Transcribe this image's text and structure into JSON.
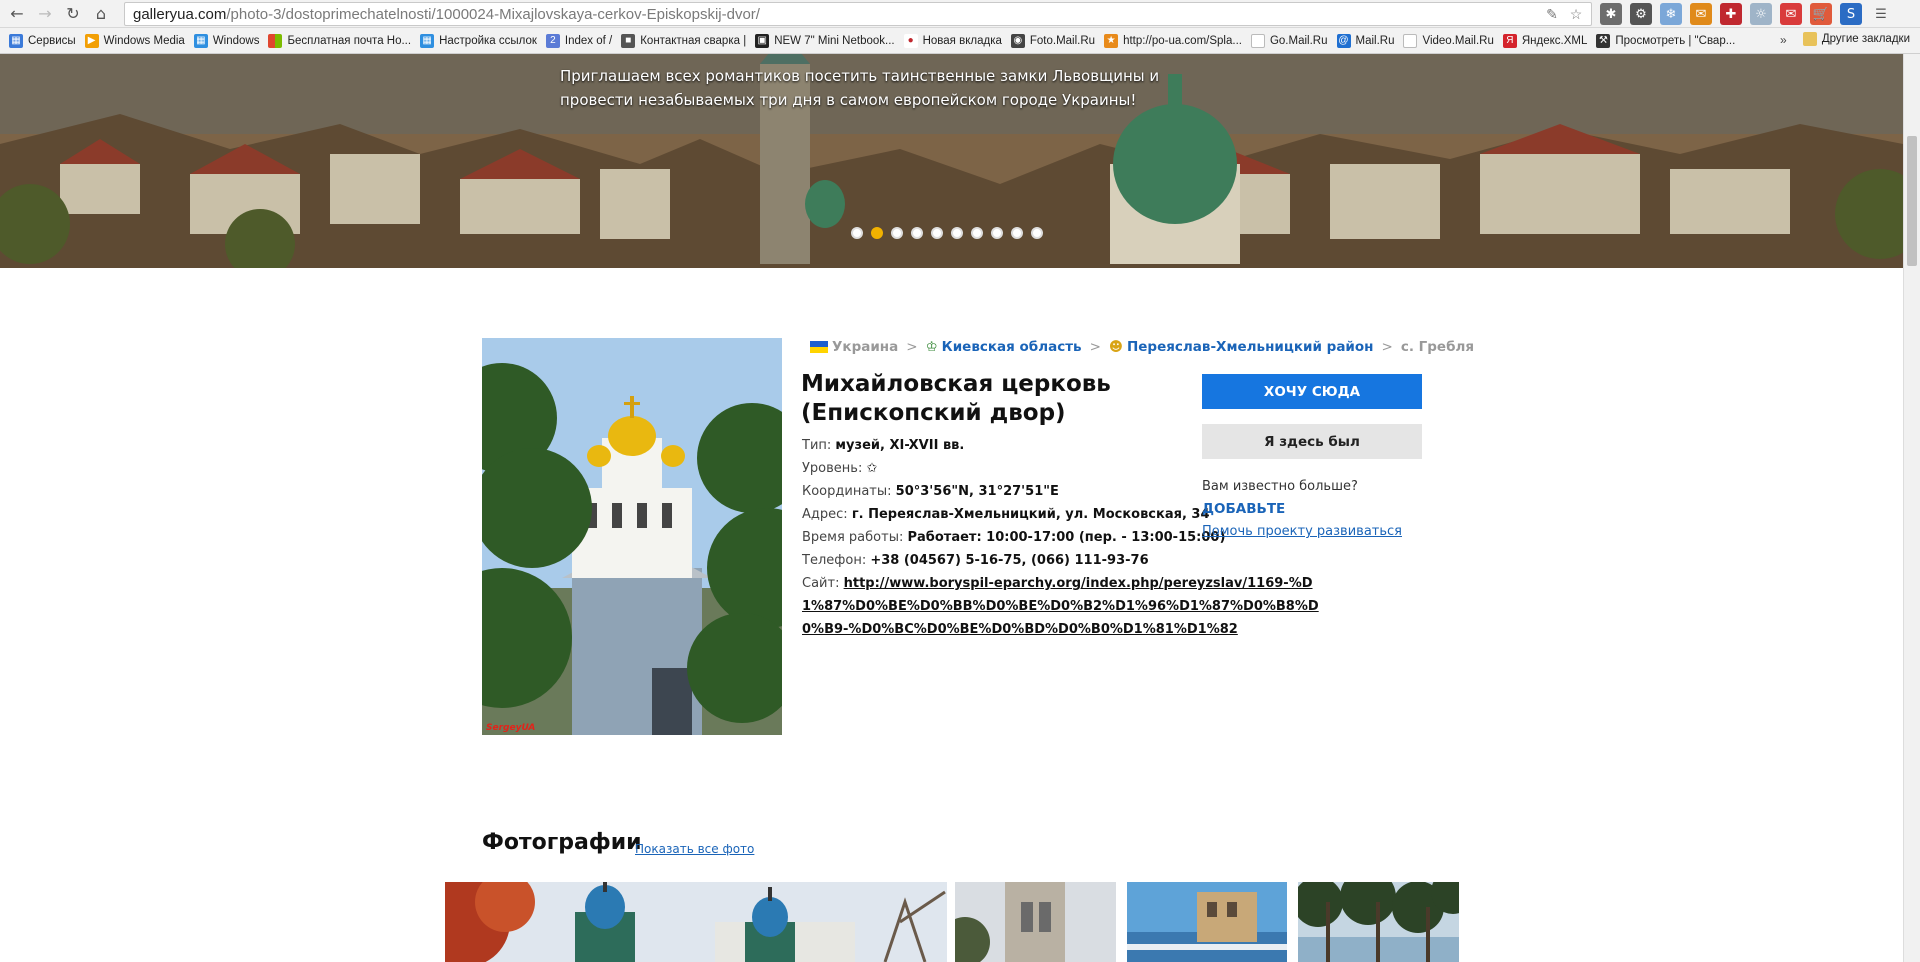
{
  "browser": {
    "url_host": "galleryua.com",
    "url_path": "/photo-3/dostoprimechatelnosti/1000024-Mixajlovskaya-cerkov-Episkopskij-dvor/",
    "bookmarks": [
      {
        "label": "Сервисы",
        "icon": "apps-grid-icon",
        "color": "#3b7ad9"
      },
      {
        "label": "Windows Media",
        "icon": "windows-media-icon",
        "color": "#f29f05"
      },
      {
        "label": "Windows",
        "icon": "windows-icon",
        "color": "#2f8fe0"
      },
      {
        "label": "Бесплатная почта Но...",
        "icon": "windows-flag-icon",
        "color": "#e0462f"
      },
      {
        "label": "Настройка ссылок",
        "icon": "windows-icon",
        "color": "#2f8fe0"
      },
      {
        "label": "Index of /",
        "icon": "number-two-icon",
        "color": "#5b7bd6"
      },
      {
        "label": "Контактная сварка |",
        "icon": "welding-site-icon",
        "color": "#555555"
      },
      {
        "label": "NEW 7\" Mini Netbook...",
        "icon": "tv-icon",
        "color": "#222222"
      },
      {
        "label": "Новая вкладка",
        "icon": "dots-icon",
        "color": "#c0282f"
      },
      {
        "label": "Foto.Mail.Ru",
        "icon": "camera-icon",
        "color": "#444444"
      },
      {
        "label": "http://po-ua.com/Spla...",
        "icon": "site-icon",
        "color": "#e88a1a"
      },
      {
        "label": "Go.Mail.Ru",
        "icon": "page-icon",
        "color": "#bbbbbb"
      },
      {
        "label": "Mail.Ru",
        "icon": "at-sign-icon",
        "color": "#1f6fd1"
      },
      {
        "label": "Video.Mail.Ru",
        "icon": "page-icon",
        "color": "#bbbbbb"
      },
      {
        "label": "Яндекс.XML",
        "icon": "yandex-xml-icon",
        "color": "#d4232c"
      },
      {
        "label": "Просмотреть | \"Свар...",
        "icon": "welder-icon",
        "color": "#333333"
      }
    ],
    "bookmarks_more": "»",
    "other_bookmarks": "Другие закладки"
  },
  "hero": {
    "text": "Приглашаем всех романтиков посетить таинственные замки Львовщины и провести незабываемых три дня в самом европейском городе Украины!",
    "slides": 10,
    "active_slide": 2
  },
  "breadcrumb": {
    "country": "Украина",
    "region": "Киевская область",
    "district": "Переяслав-Хмельницкий район",
    "village": "с. Гребля",
    "separator": ">"
  },
  "place": {
    "title": "Михайловская церковь (Епископский двор)",
    "photo_credit": "SergeyUA",
    "fields": {
      "type_label": "Тип:",
      "type_value": "музей, XI-XVII вв.",
      "level_label": "Уровень:",
      "level_value": "✩",
      "coords_label": "Координаты:",
      "coords_value": "50°3'56\"N, 31°27'51\"E",
      "address_label": "Адрес:",
      "address_value": "г. Переяслав-Хмельницкий, ул. Московская, 34",
      "hours_label": "Время работы:",
      "hours_value": "Работает: 10:00-17:00 (пер. - 13:00-15:00)",
      "phone_label": "Телефон:",
      "phone_value": "+38 (04567) 5-16-75, (066) 111-93-76",
      "site_label": "Сайт:",
      "site_value": "http://www.boryspil-eparchy.org/index.php/pereyzslav/1169-%D1%87%D0%BE%D0%BB%D0%BE%D0%B2%D1%96%D1%87%D0%B8%D0%B9-%D0%BC%D0%BE%D0%BD%D0%B0%D1%81%D1%82"
    }
  },
  "actions": {
    "want_label": "ХОЧУ СЮДА",
    "been_label": "Я здесь был",
    "more_question": "Вам известно больше?",
    "add_label": "ДОБАВЬТЕ",
    "help_label": "Помочь проекту развиваться"
  },
  "photos": {
    "title": "Фотографии",
    "show_all": "Показать все фото"
  }
}
